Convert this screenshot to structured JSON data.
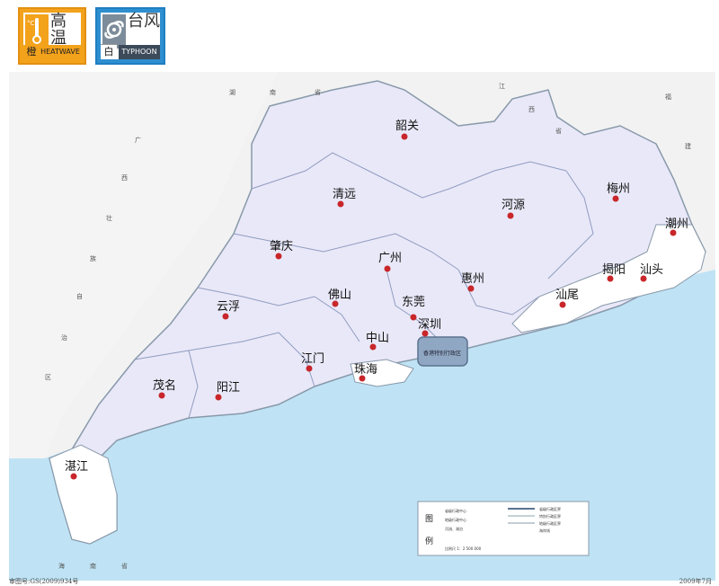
{
  "badges": [
    {
      "name": "heatwave",
      "level": "橙",
      "title": "高温",
      "english": "HEATWAVE",
      "color": "#f3a21b",
      "icon": "thermometer-icon",
      "icon_text": "°C"
    },
    {
      "name": "typhoon",
      "level": "白",
      "title": "台风",
      "english": "TYPHOON",
      "color": "#2e8fd0",
      "icon": "typhoon-icon"
    }
  ],
  "map": {
    "province_color": "#e9e8f8",
    "alert_color": "#ffffff",
    "sea_color": "#bfe3f4",
    "cities": [
      {
        "name": "韶关"
      },
      {
        "name": "清远"
      },
      {
        "name": "河源"
      },
      {
        "name": "梅州"
      },
      {
        "name": "潮州"
      },
      {
        "name": "肇庆"
      },
      {
        "name": "广州"
      },
      {
        "name": "揭阳"
      },
      {
        "name": "汕头"
      },
      {
        "name": "云浮"
      },
      {
        "name": "佛山"
      },
      {
        "name": "东莞"
      },
      {
        "name": "惠州"
      },
      {
        "name": "汕尾"
      },
      {
        "name": "深圳"
      },
      {
        "name": "中山"
      },
      {
        "name": "江门"
      },
      {
        "name": "珠海"
      },
      {
        "name": "茂名"
      },
      {
        "name": "阳江"
      },
      {
        "name": "湛江"
      }
    ],
    "neighbors": {
      "hunan": [
        "湖",
        "南",
        "省"
      ],
      "jiangxi": [
        "江",
        "西",
        "省"
      ],
      "fujian": [
        "福",
        "建"
      ],
      "guangxi": [
        "广",
        "西",
        "壮",
        "族",
        "自",
        "治",
        "区"
      ],
      "hainan": [
        "海",
        "南",
        "省"
      ]
    },
    "hk_label": "香港特别行政区",
    "legend": {
      "title": "图",
      "title2": "例",
      "items": [
        "省级行政中心",
        "地级行政中心",
        "河流、湖泊",
        "省级行政区界",
        "特别行政区界",
        "地级行政区界",
        "海岸线"
      ],
      "scale": "比例尺 1：2 500 000"
    },
    "footer_left": "审图号:GS(2009)934号",
    "footer_right": "2009年7月"
  }
}
